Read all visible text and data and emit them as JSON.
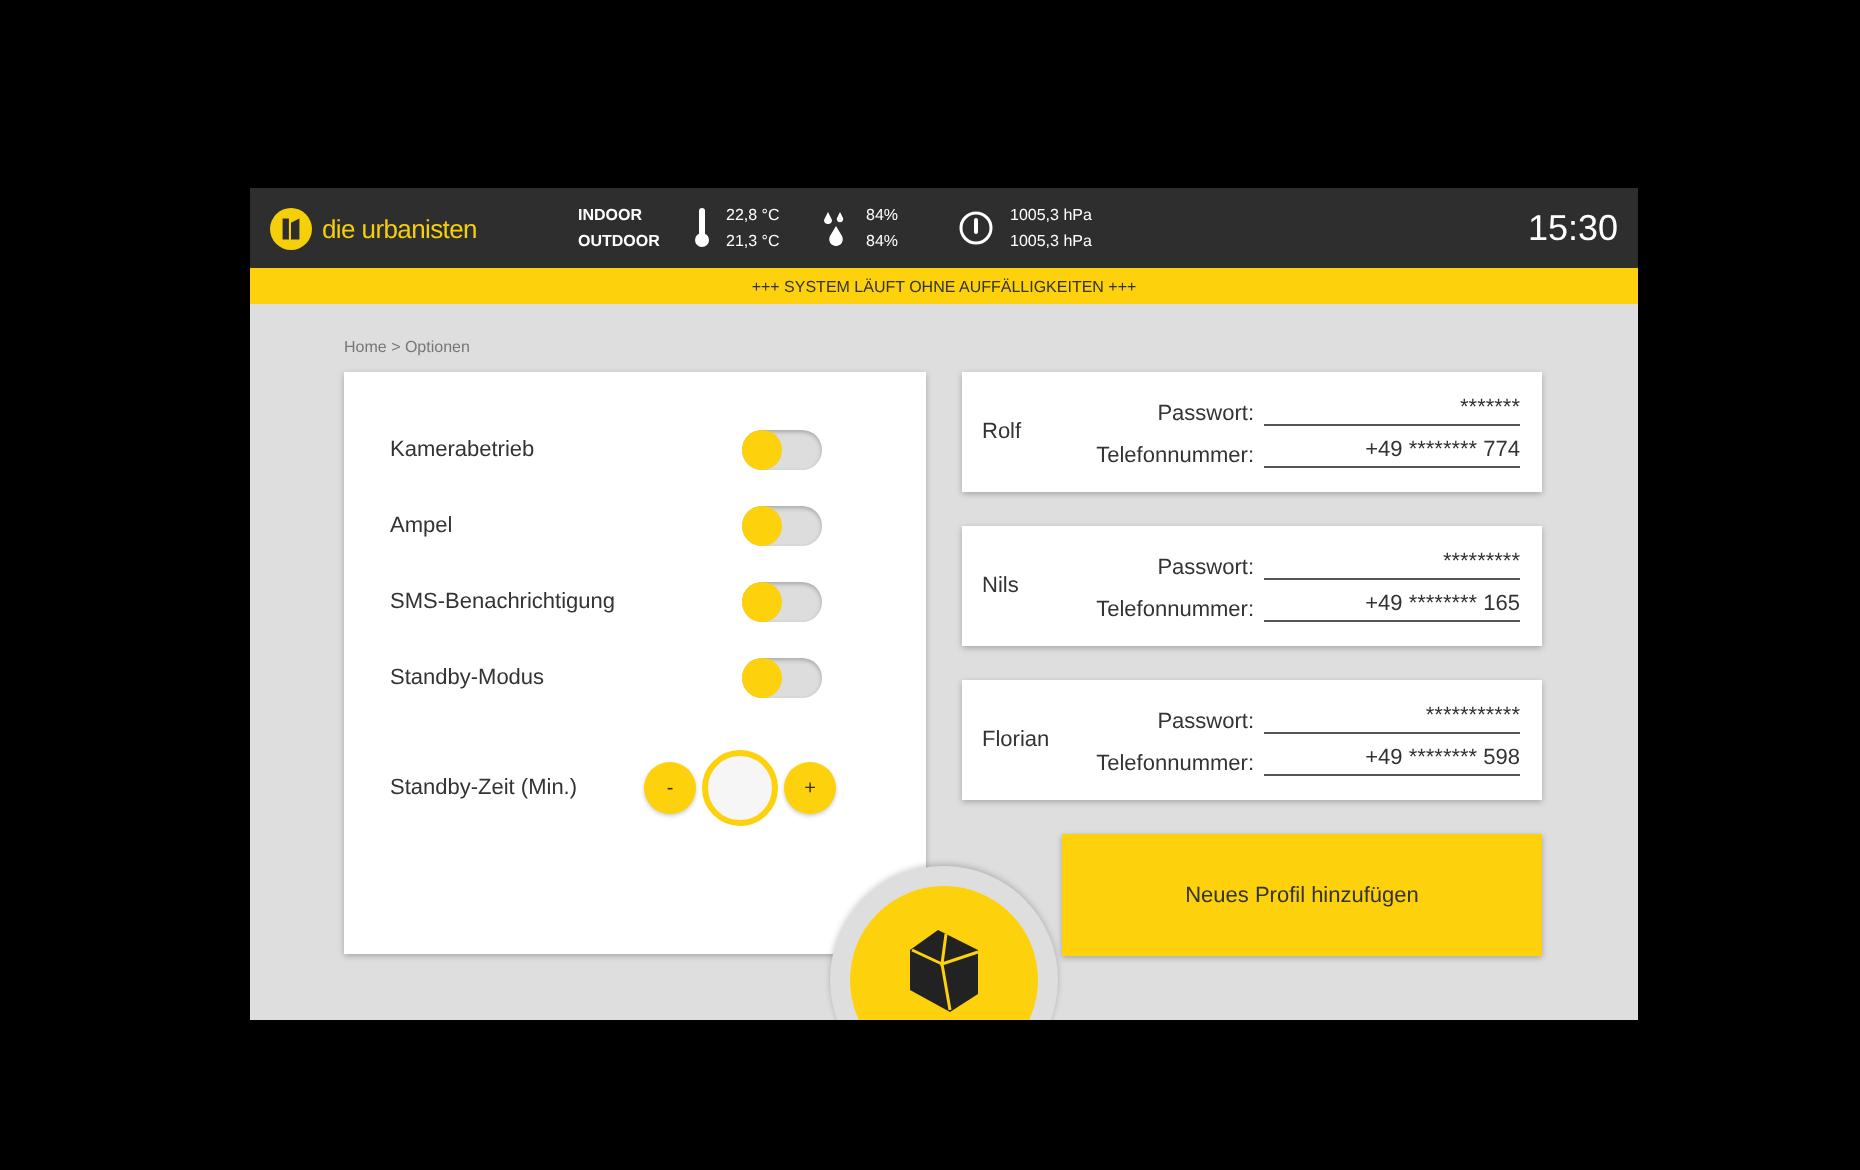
{
  "header": {
    "brand": "die urbanisten",
    "locations": [
      "INDOOR",
      "OUTDOOR"
    ],
    "temperatures": [
      "22,8 °C",
      "21,3 °C"
    ],
    "humidity": [
      "84%",
      "84%"
    ],
    "pressure": [
      "1005,3 hPa",
      "1005,3 hPa"
    ],
    "time": "15:30"
  },
  "status_banner": "+++ SYSTEM LÄUFT OHNE AUFFÄLLIGKEITEN +++",
  "breadcrumb": "Home > Optionen",
  "settings": [
    {
      "label": "Kamerabetrieb",
      "on": false
    },
    {
      "label": "Ampel",
      "on": false
    },
    {
      "label": "SMS-Benachrichtigung",
      "on": false
    },
    {
      "label": "Standby-Modus",
      "on": false
    }
  ],
  "standby_time": {
    "label": "Standby-Zeit (Min.)",
    "minus": "-",
    "plus": "+"
  },
  "profiles": [
    {
      "name": "Rolf",
      "password_label": "Passwort:",
      "password": "*******",
      "phone_label": "Telefonnummer:",
      "phone": "+49 ******** 774"
    },
    {
      "name": "Nils",
      "password_label": "Passwort:",
      "password": "*********",
      "phone_label": "Telefonnummer:",
      "phone": "+49 ******** 165"
    },
    {
      "name": "Florian",
      "password_label": "Passwort:",
      "password": "***********",
      "phone_label": "Telefonnummer:",
      "phone": "+49 ******** 598"
    }
  ],
  "add_profile_button": "Neues Profil hinzufügen"
}
